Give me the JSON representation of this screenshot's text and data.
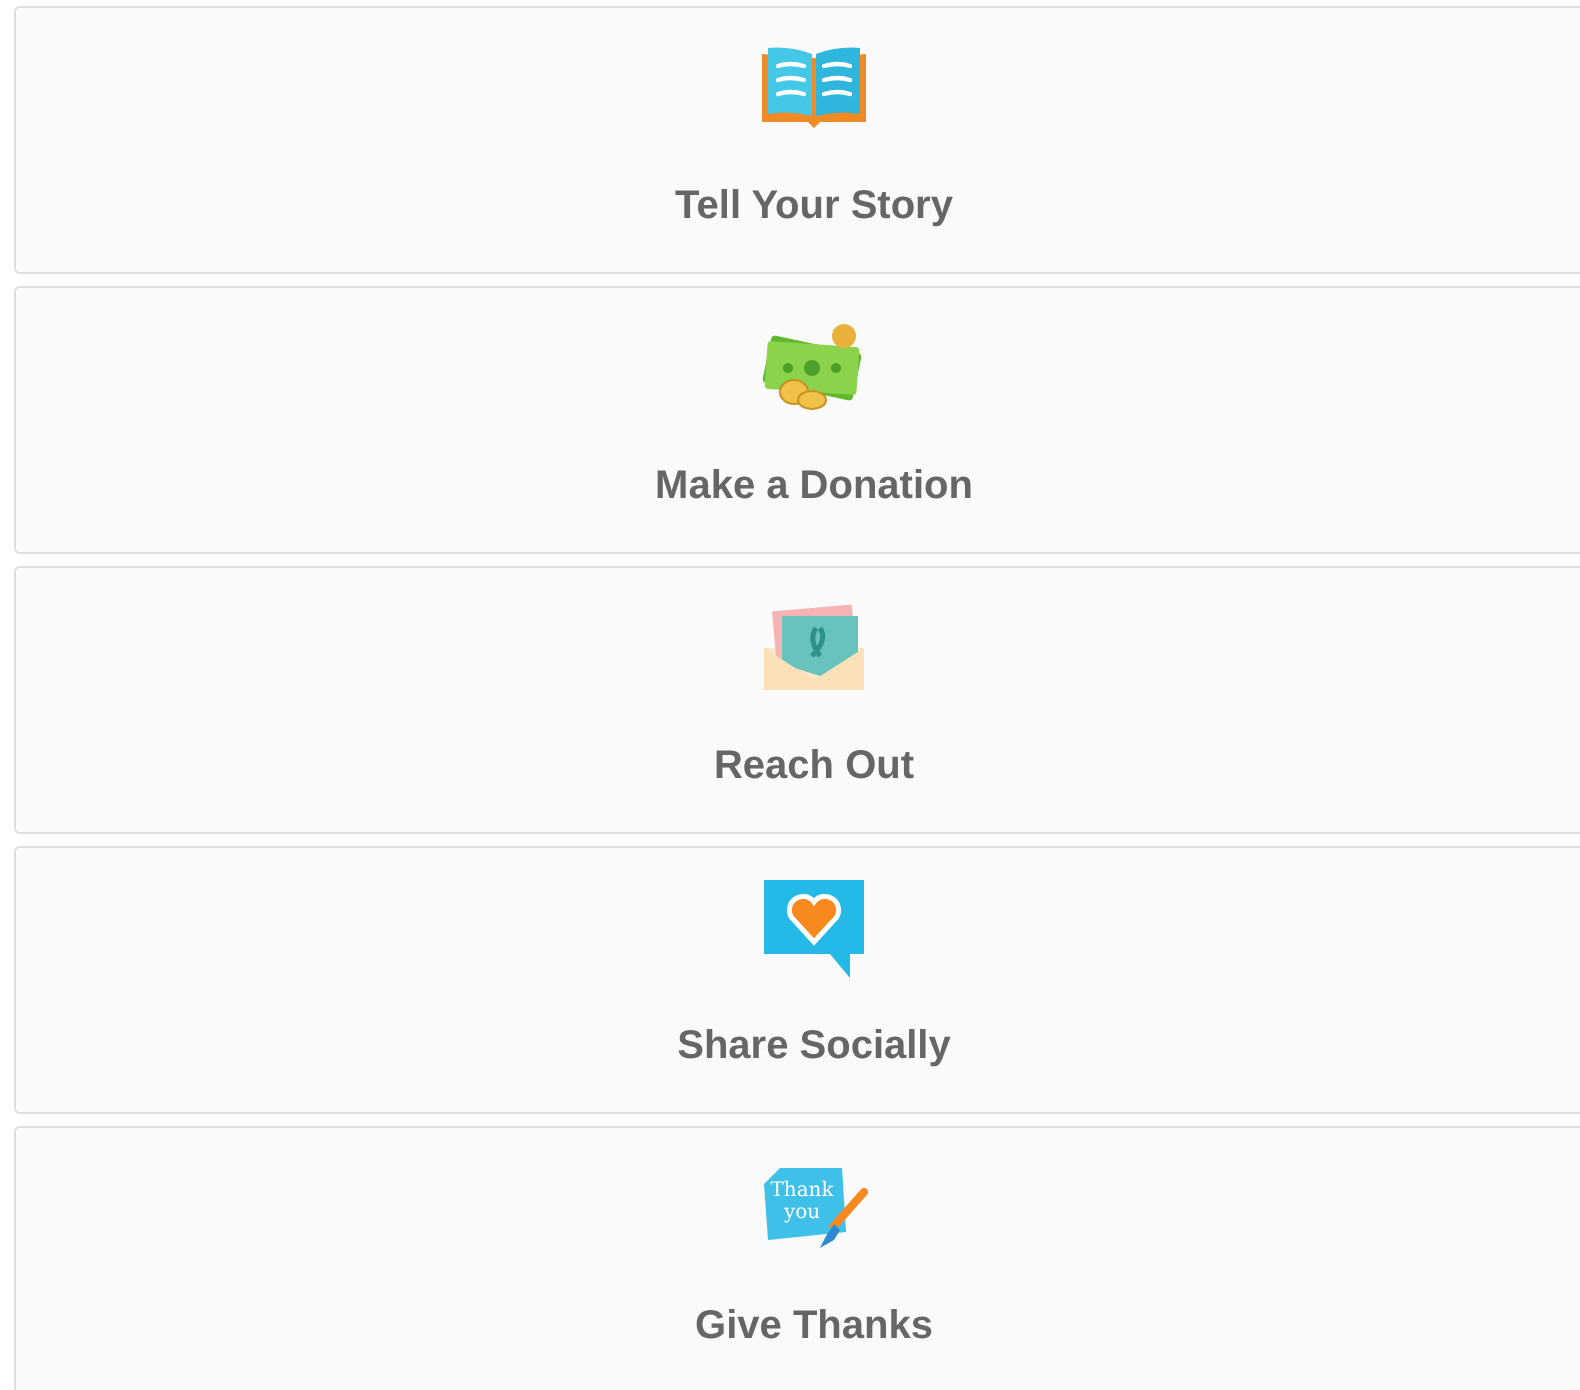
{
  "cards": [
    {
      "kind": "book",
      "label": "Tell Your Story"
    },
    {
      "kind": "money",
      "label": "Make a Donation"
    },
    {
      "kind": "envelope",
      "label": "Reach Out"
    },
    {
      "kind": "chat",
      "label": "Share Socially"
    },
    {
      "kind": "thanks",
      "label": "Give Thanks",
      "icon_text": [
        "Thank",
        "you"
      ]
    }
  ]
}
